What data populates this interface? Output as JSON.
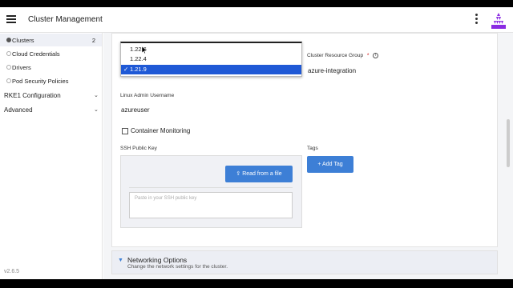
{
  "header": {
    "title": "Cluster Management"
  },
  "sidebar": {
    "items": [
      {
        "label": "Clusters",
        "count": "2"
      },
      {
        "label": "Cloud Credentials"
      },
      {
        "label": "Drivers"
      },
      {
        "label": "Pod Security Policies"
      }
    ],
    "groups": [
      {
        "label": "RKE1 Configuration"
      },
      {
        "label": "Advanced"
      }
    ],
    "version": "v2.6.5"
  },
  "form": {
    "version_dropdown": {
      "options": [
        "1.22.6",
        "1.22.4",
        "1.21.9"
      ],
      "selected": "1.21.9",
      "check": "✓"
    },
    "resource_group": {
      "label": "Cluster Resource Group",
      "required": "*",
      "value": "azure-integration",
      "info_icon": "info-icon"
    },
    "admin_username": {
      "label": "Linux Admin Username",
      "value": "azureuser"
    },
    "container_monitoring": {
      "label": "Container Monitoring",
      "checked": false
    },
    "ssh": {
      "label": "SSH Public Key",
      "read_button": "Read from a file",
      "placeholder": "Paste in your SSH public key"
    },
    "tags": {
      "label": "Tags",
      "add_button": "Add Tag"
    }
  },
  "networking": {
    "title": "Networking Options",
    "subtitle": "Change the network settings for the cluster."
  },
  "colors": {
    "accent": "#3d7fd6",
    "selection": "#1f59d6",
    "logo": "#8a2be2"
  }
}
